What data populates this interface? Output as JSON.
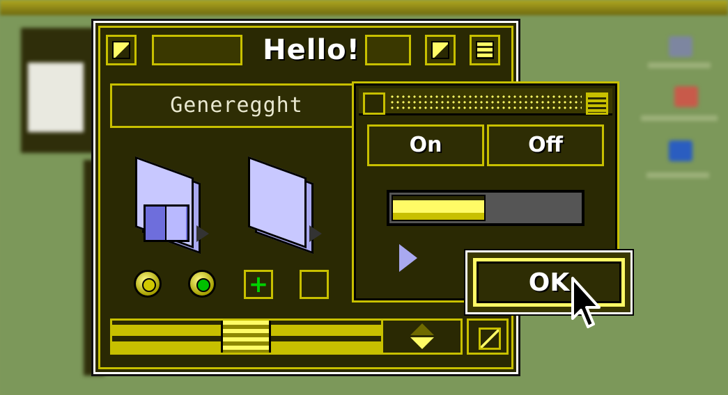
{
  "window": {
    "title": "Hello!"
  },
  "tab": {
    "label": "Generegght"
  },
  "dialog": {
    "on_label": "On",
    "off_label": "Off",
    "slider_level": 0.5
  },
  "ok_button": {
    "label": "OK"
  },
  "colors": {
    "accent": "#fffb66",
    "frame": "#c8c000",
    "window_bg": "#2a2903",
    "folder": "#c8c8ff",
    "check": "#00d000",
    "desktop": "#7c985a"
  }
}
